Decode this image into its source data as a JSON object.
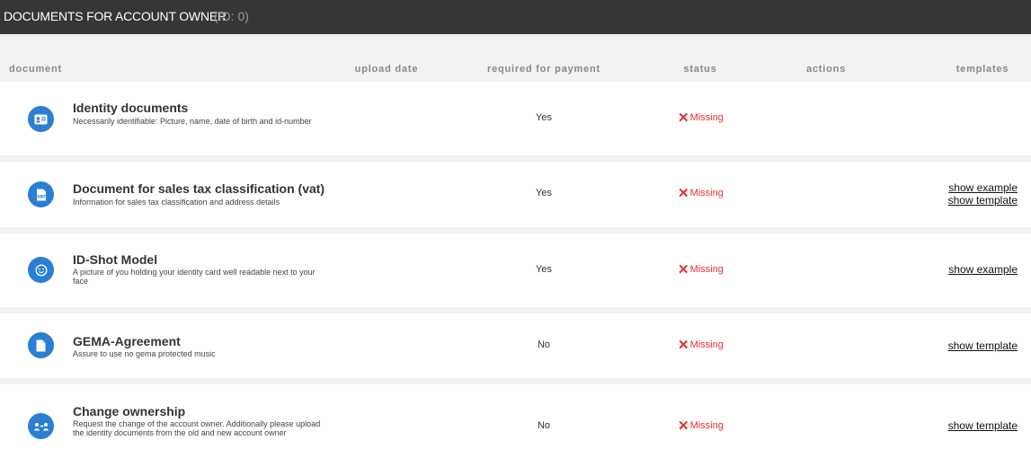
{
  "header": {
    "title": "DOCUMENTS FOR ACCOUNT OWNER",
    "id_label": "(ID: 0)"
  },
  "columns": {
    "document": "document",
    "upload_date": "upload date",
    "required": "required for payment",
    "status": "status",
    "actions": "actions",
    "templates": "templates"
  },
  "rows": [
    {
      "icon": "id-card-icon",
      "name": "Identity documents",
      "description": "Necessarily identifiable: Picture, name, date of birth and id-number",
      "required": "Yes",
      "status": "Missing",
      "links": []
    },
    {
      "icon": "vat-document-icon",
      "name": "Document for sales tax classification (vat)",
      "description": "Information for sales tax classification and address details",
      "required": "Yes",
      "status": "Missing",
      "links": [
        "show example",
        "show template"
      ]
    },
    {
      "icon": "smiley-face-icon",
      "name": "ID-Shot Model",
      "description": "A picture of you holding your identity card well readable next to your face",
      "required": "Yes",
      "status": "Missing",
      "links": [
        "show example"
      ]
    },
    {
      "icon": "document-icon",
      "name": "GEMA-Agreement",
      "description": "Assure to use no gema protected music",
      "required": "No",
      "status": "Missing",
      "links": [
        "show template"
      ]
    },
    {
      "icon": "change-owner-icon",
      "name": "Change ownership",
      "description": "Request the change of the account owner. Additionally please upload the identity documents from the old and new account owner",
      "required": "No",
      "status": "Missing",
      "links": [
        "show template"
      ]
    }
  ],
  "colors": {
    "header_bg": "#363636",
    "accent": "#2a7fd4",
    "missing": "#e03030"
  }
}
